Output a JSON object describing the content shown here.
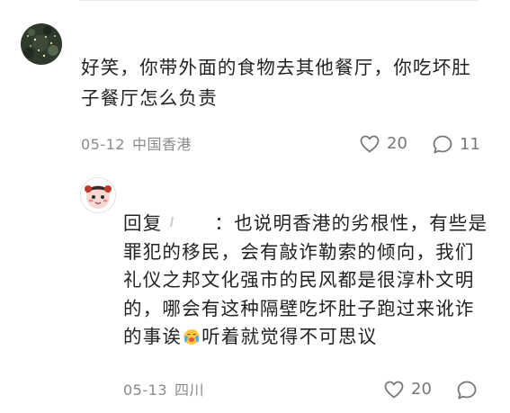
{
  "comment": {
    "text": "好笑，你带外面的食物去其他餐厅，你吃坏肚子餐厅怎么负责",
    "date": "05-12",
    "location": "中国香港",
    "likes": "20",
    "replies": "11"
  },
  "reply": {
    "prefix": "回复",
    "line1_rest": "：也说明香港的劣根性，有些是",
    "line2": "罪犯的移民，会有敲诈勒索的倾向，我们",
    "line3": "礼仪之邦文化强市的民风都是很淳朴文明",
    "line4": "的，哪会有这种隔壁吃坏肚子跑过来讹诈",
    "line5_before_emoji": "的事诶",
    "line5_after_emoji": "听着就觉得不可思议",
    "date": "05-13",
    "location": "四川",
    "likes": "20"
  },
  "icons": {
    "like": "heart-outline-icon",
    "reply": "speech-bubble-icon",
    "emoji": "crying-face-emoji"
  },
  "colors": {
    "text": "#222222",
    "meta": "#8a8a8a",
    "icon": "#777777"
  }
}
